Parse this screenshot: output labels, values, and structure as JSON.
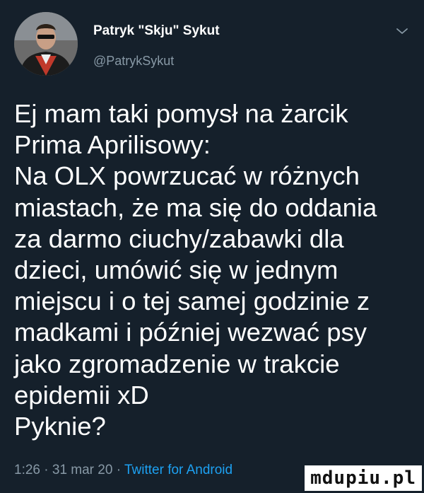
{
  "tweet": {
    "author": {
      "display_name": "Patryk \"Skju\" Sykut",
      "handle": "@PatrykSykut",
      "avatar_icon": "user-photo"
    },
    "menu_icon": "chevron-down-icon",
    "text_lines": [
      "Ej mam taki pomysł na żarcik",
      "Prima Aprilisowy:",
      "Na OLX powrzucać w różnych",
      "miastach, że ma się do oddania",
      "za darmo ciuchy/zabawki dla",
      "dzieci, umówić się w jednym",
      "miejscu i o tej samej godzinie z",
      "madkami i później wezwać psy",
      "jako zgromadzenie w trakcie",
      "epidemii xD",
      "Pyknie?"
    ],
    "time": "1:26",
    "separator": "·",
    "date": "31 mar 20",
    "source": "Twitter for Android"
  },
  "watermark": {
    "text": "mdupiu.pl"
  },
  "colors": {
    "background": "#15202b",
    "text": "#ffffff",
    "secondary": "#8899a6",
    "link": "#1da1f2"
  }
}
